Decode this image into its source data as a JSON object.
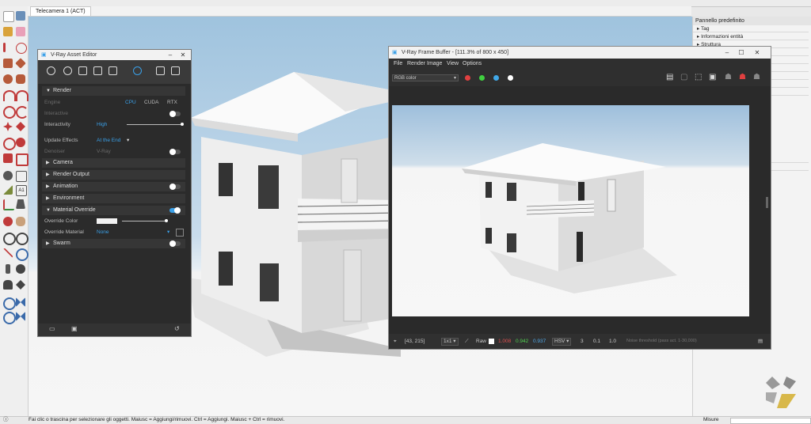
{
  "scene_tab": "Telecamera 1 (ACT)",
  "right_panel": {
    "title": "Pannello predefinito",
    "items": [
      "Tag",
      "Informazioni entità",
      "Struttura"
    ]
  },
  "status_bar": {
    "hint": "Fai clic o trascina per selezionare gli oggetti. Maiusc = Aggiungi/rimuovi. Ctrl = Aggiungi. Maiusc + Ctrl = rimuovi.",
    "measure_label": "Misure"
  },
  "asset_editor": {
    "title": "V-Ray Asset Editor",
    "sections": {
      "render": "Render",
      "camera": "Camera",
      "render_output": "Render Output",
      "animation": "Animation",
      "environment": "Environment",
      "material_override": "Material Override",
      "swarm": "Swarm"
    },
    "engine_label": "Engine",
    "engine_options": [
      "CPU",
      "CUDA",
      "RTX"
    ],
    "interactive_label": "Interactive",
    "interactivity_label": "Interactivity",
    "interactivity_value": "High",
    "update_effects_label": "Update Effects",
    "update_effects_value": "At the End",
    "denoiser_label": "Denoiser",
    "denoiser_value": "V-Ray",
    "override_color_label": "Override Color",
    "override_material_label": "Override Material",
    "override_material_value": "None"
  },
  "frame_buffer": {
    "title": "V-Ray Frame Buffer - [111.3% of 800 x 450]",
    "menu": [
      "File",
      "Render",
      "Image",
      "View",
      "Options"
    ],
    "channel": "RGB color",
    "coords": "[43, 215]",
    "zoom": "1x1",
    "raw_label": "Raw",
    "rgb_values": [
      "1.008",
      "0.942",
      "0.937"
    ],
    "color_space": "HSV",
    "values": [
      "3",
      "0.1",
      "1.0"
    ],
    "noise_text": "Noise threshold (pass act. 1-30,000)"
  },
  "colors": {
    "accent": "#3aa0e8",
    "dark_panel": "#2b2b2b"
  }
}
